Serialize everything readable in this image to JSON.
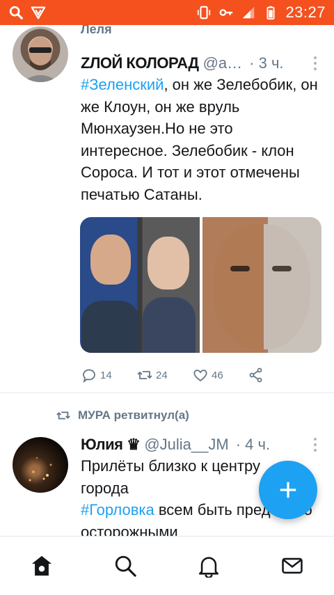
{
  "status_bar": {
    "time": "23:27",
    "left_icons": [
      "search-icon",
      "vpn-shield-icon"
    ],
    "right_icons": [
      "vibrate-icon",
      "key-icon",
      "signal-icon",
      "battery-icon"
    ],
    "colors": {
      "background": "#f4511e"
    }
  },
  "timeline": {
    "prev_author_name": "Леля",
    "tweets": [
      {
        "author_name": "ZЛОЙ КОЛОРАД",
        "handle": "@a…",
        "time": "· 3 ч.",
        "text_hashtag": "#Зеленский",
        "text_rest": ", он же Зелебобик, он же Клоун, он же вруль Мюнхаузен.Но не это интересное. Зелебобик - клон Сороса. И тот и этот отмечены печатью Сатаны.",
        "reply_count": "14",
        "retweet_count": "24",
        "like_count": "46"
      },
      {
        "retweet_label": "МУРА ретвитнул(а)",
        "author_name": "Юлия ♛",
        "handle": "@Julia__JM",
        "time": "· 4 ч.",
        "text_line1": "Прилёты близко к центру",
        "text_line2": "города",
        "text_hashtag": "#Горловка",
        "text_rest": " всем быть предельно осторожными"
      }
    ]
  },
  "fab": {
    "icon": "plus-icon",
    "color": "#1da1f2"
  },
  "bottom_nav": {
    "items": [
      "home-icon",
      "search-icon",
      "notifications-icon",
      "messages-icon"
    ]
  },
  "colors": {
    "accent": "#1da1f2",
    "muted": "#657786",
    "text": "#14171a"
  }
}
